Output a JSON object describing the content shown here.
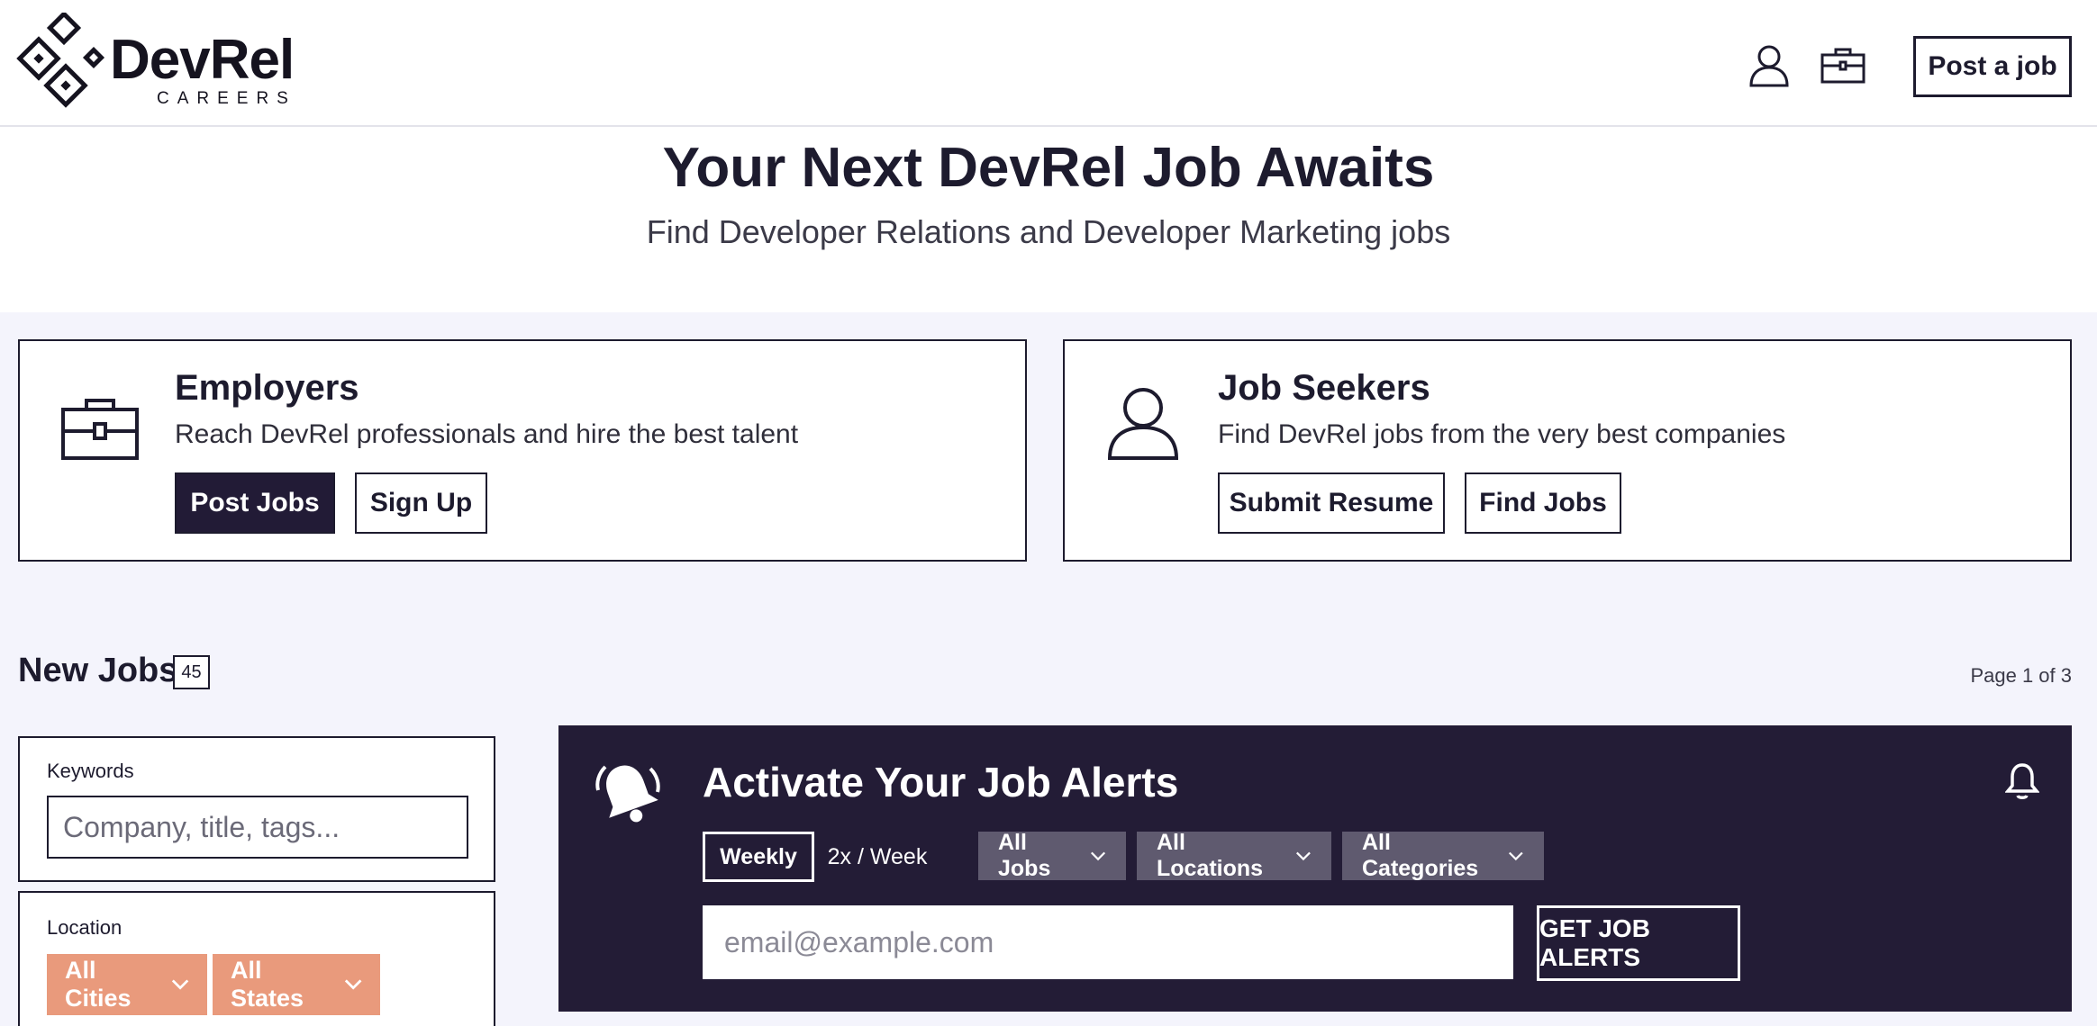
{
  "header": {
    "logo_word": "DevRel",
    "logo_sub": "CAREERS",
    "account_icon": "user-icon",
    "jobs_icon": "briefcase-icon",
    "post_job_label": "Post a job"
  },
  "hero": {
    "title": "Your Next DevRel Job Awaits",
    "subtitle": "Find Developer Relations and Developer Marketing jobs"
  },
  "cards": {
    "employers": {
      "icon": "briefcase-icon",
      "title": "Employers",
      "description": "Reach DevRel professionals and hire the best talent",
      "primary_label": "Post Jobs",
      "secondary_label": "Sign Up"
    },
    "job_seekers": {
      "icon": "user-icon",
      "title": "Job Seekers",
      "description": "Find DevRel jobs from the very best companies",
      "primary_label": "Submit Resume",
      "secondary_label": "Find Jobs"
    }
  },
  "jobs": {
    "title": "New Jobs",
    "count": "45",
    "page_indicator": "Page 1 of 3"
  },
  "filters": {
    "keywords_label": "Keywords",
    "keywords_placeholder": "Company, title, tags...",
    "location_label": "Location",
    "cities_label": "All Cities",
    "states_label": "All States"
  },
  "alerts": {
    "title": "Activate Your Job Alerts",
    "frequency_weekly": "Weekly",
    "frequency_twice": "2x / Week",
    "jobs_dropdown": "All Jobs",
    "locations_dropdown": "All Locations",
    "categories_dropdown": "All Categories",
    "email_placeholder": "email@example.com",
    "button_label": "GET JOB ALERTS"
  },
  "colors": {
    "brand_dark": "#221b36",
    "pill_accent": "#e99a7c",
    "page_bg": "#f4f4fc"
  }
}
